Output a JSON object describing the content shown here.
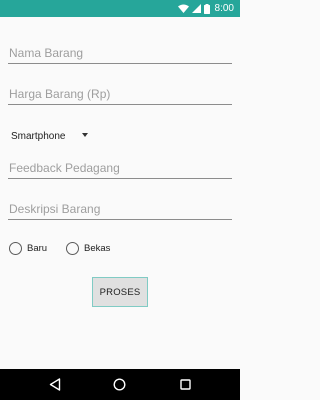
{
  "status_bar": {
    "time": "8:00",
    "background": "#26A69A",
    "icons": [
      "wifi-icon",
      "cellular-signal-icon",
      "battery-icon"
    ]
  },
  "form": {
    "nama_barang": {
      "placeholder": "Nama Barang",
      "value": ""
    },
    "harga_barang": {
      "placeholder": "Harga Barang (Rp)",
      "value": ""
    },
    "kategori": {
      "selected": "Smartphone"
    },
    "feedback": {
      "placeholder": "Feedback Pedagang",
      "value": ""
    },
    "deskripsi": {
      "placeholder": "Deskripsi Barang",
      "value": ""
    },
    "kondisi": {
      "options": [
        {
          "label": "Baru",
          "checked": false
        },
        {
          "label": "Bekas",
          "checked": false
        }
      ]
    },
    "submit_label": "PROSES",
    "button_border_color": "#80CBC4"
  },
  "nav_bar": {
    "buttons": [
      "back-icon",
      "home-icon",
      "recents-icon"
    ]
  }
}
